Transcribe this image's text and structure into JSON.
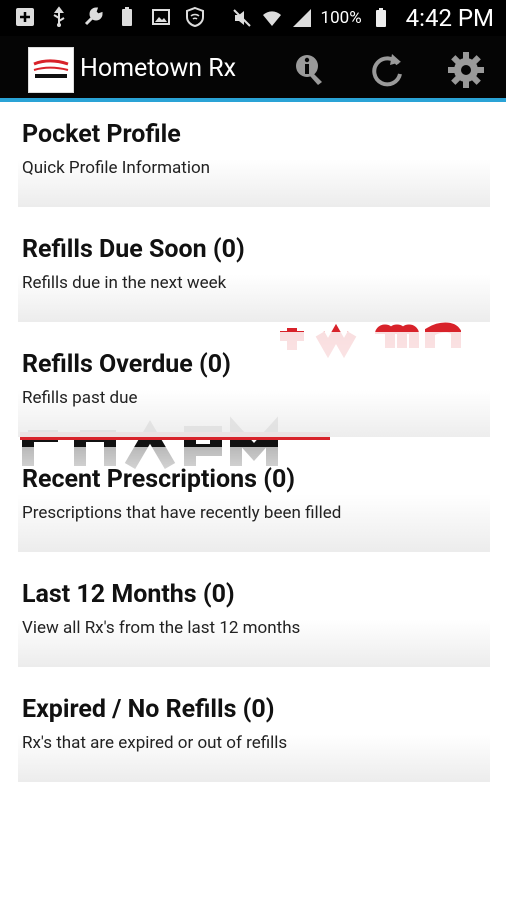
{
  "status_bar": {
    "battery_percent": "100%",
    "time": "4:42 PM",
    "icons": [
      "add-box-icon",
      "usb-icon",
      "wrench-icon",
      "battery-full-icon",
      "image-icon",
      "shield-icon",
      "mute-icon",
      "wifi-icon",
      "signal-icon",
      "battery-icon"
    ]
  },
  "action_bar": {
    "title": "Hometown Rx",
    "accent_color": "#2aa3d6",
    "icons": [
      "info-icon",
      "refresh-icon",
      "gear-icon"
    ]
  },
  "cards": [
    {
      "title": "Pocket Profile",
      "subtitle": "Quick Profile Information"
    },
    {
      "title": "Refills Due Soon (0)",
      "subtitle": "Refills due in the next week"
    },
    {
      "title": "Refills Overdue (0)",
      "subtitle": "Refills past due"
    },
    {
      "title": "Recent Prescriptions (0)",
      "subtitle": "Prescriptions that have recently been filled"
    },
    {
      "title": "Last 12 Months (0)",
      "subtitle": "View all Rx's from the last 12 months"
    },
    {
      "title": "Expired / No Refills (0)",
      "subtitle": "Rx's that are expired or out of refills"
    }
  ]
}
